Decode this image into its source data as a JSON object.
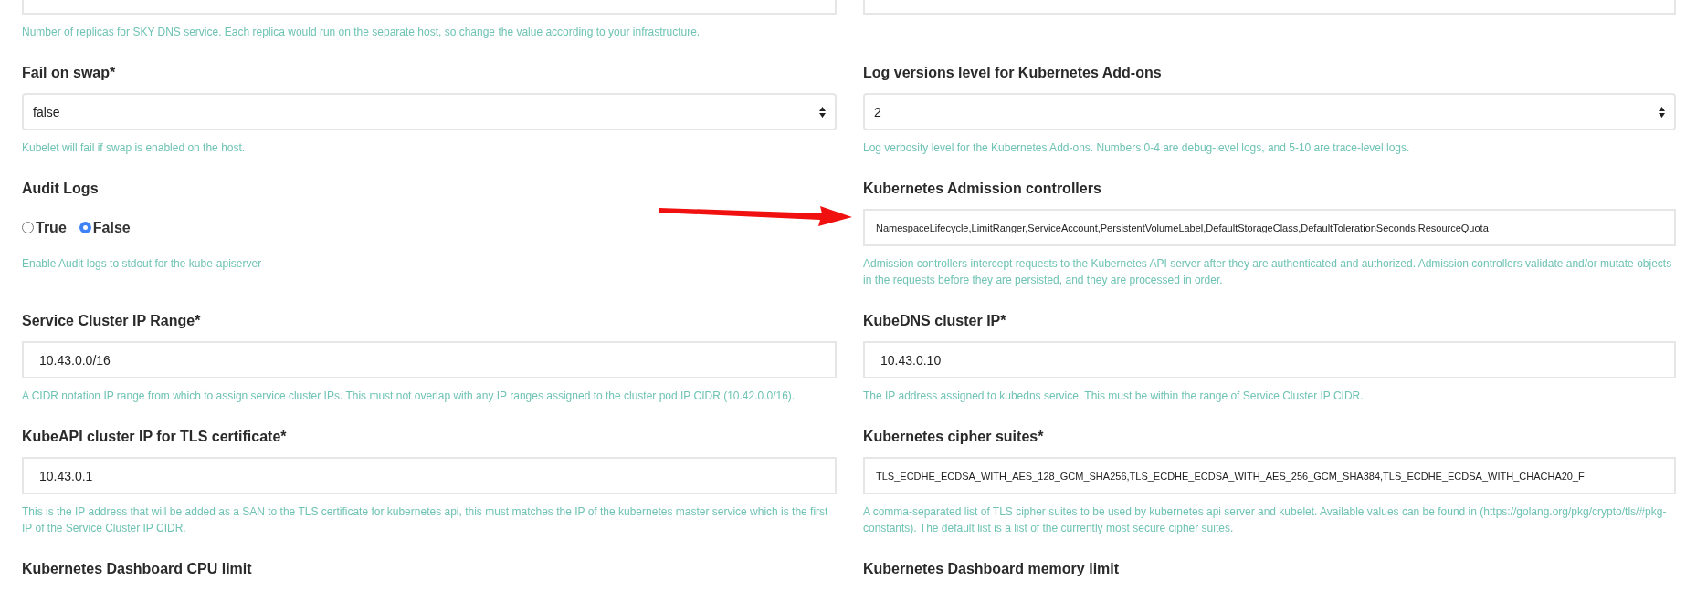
{
  "rows": [
    [
      {
        "kind": "text",
        "help": "Number of replicas for SKY DNS service. Each replica would run on the separate host, so change the value according to your infrastructure."
      },
      {
        "kind": "text"
      }
    ],
    [
      {
        "kind": "select",
        "label": "Fail on swap*",
        "value": "false",
        "help": "Kubelet will fail if swap is enabled on the host."
      },
      {
        "kind": "select",
        "label": "Log versions level for Kubernetes Add-ons",
        "value": "2",
        "help": "Log verbosity level for the Kubernetes Add-ons. Numbers 0-4 are debug-level logs, and 5-10 are trace-level logs."
      }
    ],
    [
      {
        "kind": "radio",
        "label": "Audit Logs",
        "options": [
          {
            "label": "True",
            "selected": false
          },
          {
            "label": "False",
            "selected": true
          }
        ],
        "help": "Enable Audit logs to stdout for the kube-apiserver"
      },
      {
        "kind": "text",
        "label": "Kubernetes Admission controllers",
        "value": "NamespaceLifecycle,LimitRanger,ServiceAccount,PersistentVolumeLabel,DefaultStorageClass,DefaultTolerationSeconds,ResourceQuota",
        "arrow": true,
        "help": "Admission controllers intercept requests to the Kubernetes API server after they are authenticated and authorized. Admission controllers validate and/or mutate objects in the requests before they are persisted, and they are processed in order."
      }
    ],
    [
      {
        "kind": "text",
        "label": "Service Cluster IP Range*",
        "value": "10.43.0.0/16",
        "help": "A CIDR notation IP range from which to assign service cluster IPs. This must not overlap with any IP ranges assigned to the cluster pod IP CIDR (10.42.0.0/16)."
      },
      {
        "kind": "text",
        "label": "KubeDNS cluster IP*",
        "value": "10.43.0.10",
        "help": "The IP address assigned to kubedns service. This must be within the range of Service Cluster IP CIDR."
      }
    ],
    [
      {
        "kind": "text",
        "label": "KubeAPI cluster IP for TLS certificate*",
        "value": "10.43.0.1",
        "help": "This is the IP address that will be added as a SAN to the TLS certificate for kubernetes api, this must matches the IP of the kubernetes master service which is the first IP of the Service Cluster IP CIDR."
      },
      {
        "kind": "text",
        "label": "Kubernetes cipher suites*",
        "value": "TLS_ECDHE_ECDSA_WITH_AES_128_GCM_SHA256,TLS_ECDHE_ECDSA_WITH_AES_256_GCM_SHA384,TLS_ECDHE_ECDSA_WITH_CHACHA20_F",
        "help": "A comma-separated list of TLS cipher suites to be used by kubernetes api server and kubelet. Available values can be found in (https://golang.org/pkg/crypto/tls/#pkg-constants). The default list is a list of the currently most secure cipher suites."
      }
    ],
    [
      {
        "kind": "heading",
        "label": "Kubernetes Dashboard CPU limit"
      },
      {
        "kind": "heading",
        "label": "Kubernetes Dashboard memory limit"
      }
    ]
  ]
}
